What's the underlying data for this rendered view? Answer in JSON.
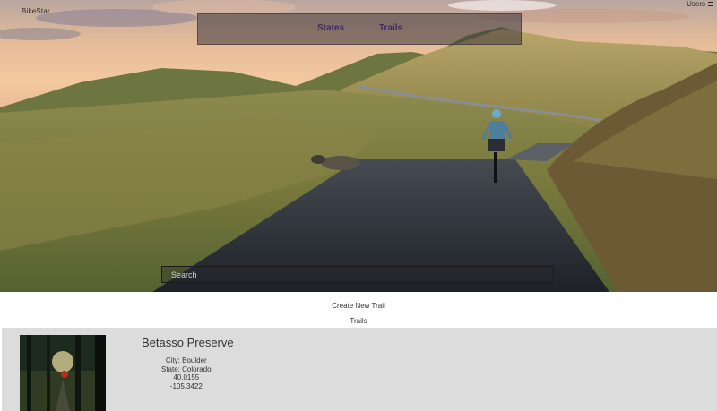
{
  "header": {
    "brand": "BikeStar",
    "users_label": "Users",
    "users_icon": "hamburger-menu-icon"
  },
  "nav": {
    "states_label": "States",
    "trails_label": "Trails"
  },
  "search": {
    "placeholder": "Search",
    "value": ""
  },
  "main": {
    "create_link": "Create New Trail",
    "trails_heading": "Trails",
    "trails": [
      {
        "name": "Betasso Preserve",
        "city": "City: Boulder",
        "state": "State: Colorado",
        "lat": "40.0155",
        "lon": "-105.3422"
      }
    ]
  },
  "colors": {
    "nav_text": "#3d2b63",
    "card_bg": "#dcdcdc"
  }
}
